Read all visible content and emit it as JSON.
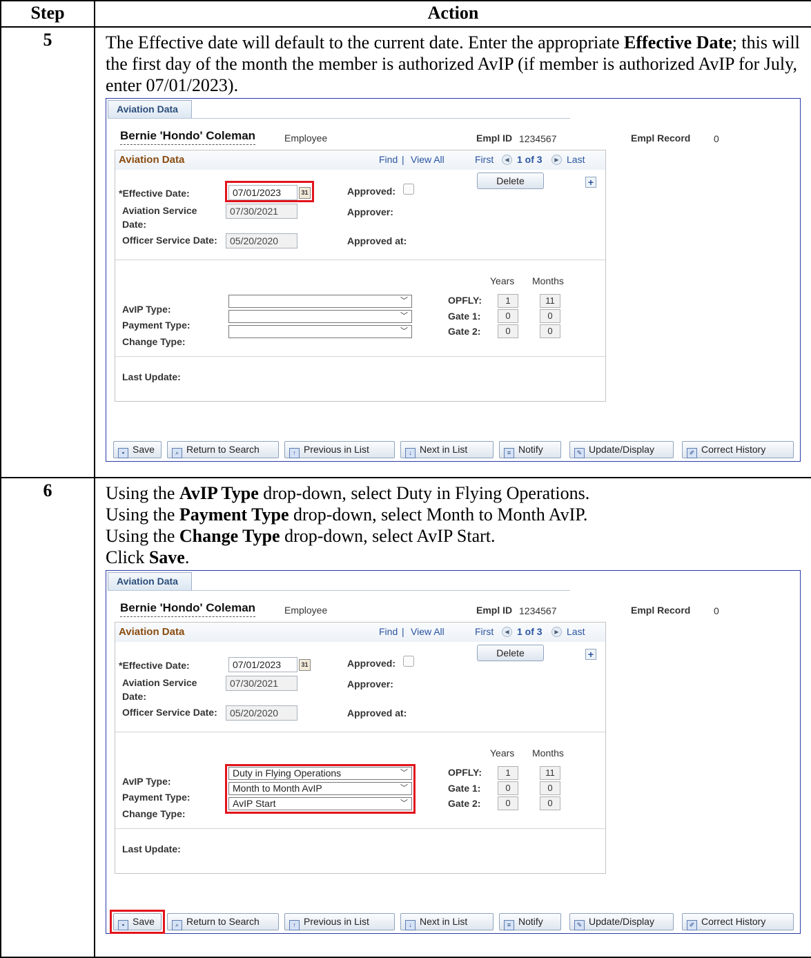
{
  "header": {
    "step": "Step",
    "action": "Action"
  },
  "rows": [
    {
      "step": "5",
      "instructions": {
        "p1_pre": "The Effective date will default to the current date. Enter the appropriate ",
        "p1_bold": "Effective Date",
        "p1_post": "; this will the first day of the month the member is authorized AvIP (if member is authorized AvIP for July, enter 07/01/2023)."
      },
      "screen": {
        "tab": "Aviation Data",
        "employee_name": "Bernie 'Hondo' Coleman",
        "employee_type": "Employee",
        "empl_id_label": "Empl ID",
        "empl_id": "1234567",
        "empl_record_label": "Empl Record",
        "empl_record": "0",
        "section_title": "Aviation Data",
        "find": "Find",
        "sep": "|",
        "view_all": "View All",
        "first": "First",
        "page": "1 of 3",
        "last": "Last",
        "delete": "Delete",
        "plus": "+",
        "effective_date_label": "*Effective Date:",
        "effective_date": "07/01/2023",
        "calendar_glyph": "31",
        "approved_label": "Approved:",
        "aviation_service_label_1": "Aviation Service",
        "aviation_service_label_2": "Date:",
        "aviation_service_date": "07/30/2021",
        "approver_label": "Approver:",
        "officer_service_label": "Officer Service Date:",
        "officer_service_date": "05/20/2020",
        "approved_at_label": "Approved at:",
        "years": "Years",
        "months": "Months",
        "avip_type_label": "AvIP Type:",
        "avip_type": "",
        "payment_type_label": "Payment Type:",
        "payment_type": "",
        "change_type_label": "Change Type:",
        "change_type": "",
        "opfly_label": "OPFLY:",
        "opfly_years": "1",
        "opfly_months": "11",
        "gate1_label": "Gate 1:",
        "gate1_years": "0",
        "gate1_months": "0",
        "gate2_label": "Gate 2:",
        "gate2_years": "0",
        "gate2_months": "0",
        "last_update_label": "Last Update:",
        "toolbar": {
          "save": "Save",
          "return": "Return to Search",
          "previous": "Previous in List",
          "next": "Next in List",
          "notify": "Notify",
          "update": "Update/Display",
          "correct": "Correct History"
        }
      }
    },
    {
      "step": "6",
      "instructions": {
        "l1_pre": "Using the ",
        "l1_bold": "AvIP Type",
        "l1_post": " drop-down, select Duty in Flying Operations.",
        "l2_pre": "Using the ",
        "l2_bold": "Payment Type",
        "l2_post": " drop-down, select Month to Month AvIP.",
        "l3_pre": "Using the ",
        "l3_bold": "Change Type",
        "l3_post": " drop-down, select AvIP Start.",
        "l4_pre": "Click ",
        "l4_bold": "Save",
        "l4_post": "."
      },
      "screen": {
        "tab": "Aviation Data",
        "employee_name": "Bernie 'Hondo' Coleman",
        "employee_type": "Employee",
        "empl_id_label": "Empl ID",
        "empl_id": "1234567",
        "empl_record_label": "Empl Record",
        "empl_record": "0",
        "section_title": "Aviation Data",
        "find": "Find",
        "sep": "|",
        "view_all": "View All",
        "first": "First",
        "page": "1 of 3",
        "last": "Last",
        "delete": "Delete",
        "plus": "+",
        "effective_date_label": "*Effective Date:",
        "effective_date": "07/01/2023",
        "calendar_glyph": "31",
        "approved_label": "Approved:",
        "aviation_service_label_1": "Aviation Service",
        "aviation_service_label_2": "Date:",
        "aviation_service_date": "07/30/2021",
        "approver_label": "Approver:",
        "officer_service_label": "Officer Service Date:",
        "officer_service_date": "05/20/2020",
        "approved_at_label": "Approved at:",
        "years": "Years",
        "months": "Months",
        "avip_type_label": "AvIP Type:",
        "avip_type": "Duty in Flying Operations",
        "payment_type_label": "Payment Type:",
        "payment_type": "Month to Month AvIP",
        "change_type_label": "Change Type:",
        "change_type": "AvIP Start",
        "opfly_label": "OPFLY:",
        "opfly_years": "1",
        "opfly_months": "11",
        "gate1_label": "Gate 1:",
        "gate1_years": "0",
        "gate1_months": "0",
        "gate2_label": "Gate 2:",
        "gate2_years": "0",
        "gate2_months": "0",
        "last_update_label": "Last Update:",
        "toolbar": {
          "save": "Save",
          "return": "Return to Search",
          "previous": "Previous in List",
          "next": "Next in List",
          "notify": "Notify",
          "update": "Update/Display",
          "correct": "Correct History"
        }
      }
    }
  ],
  "colors": {
    "highlight": "#e1141c",
    "frame": "#2a3aa8",
    "section_title": "#8a4b0f",
    "link": "#2a54a0"
  }
}
